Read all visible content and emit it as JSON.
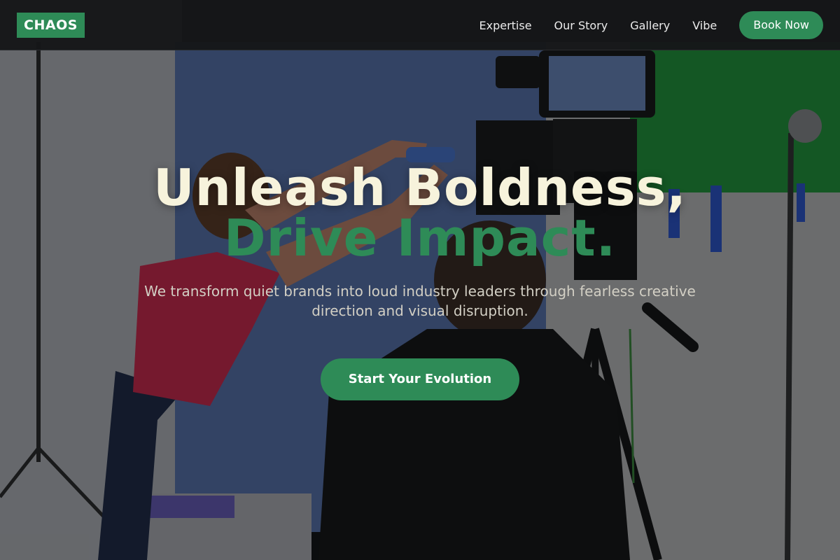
{
  "brand": {
    "logo_text": "CHAOS",
    "accent_color": "#2e8b57"
  },
  "nav": {
    "links": [
      {
        "label": "Expertise"
      },
      {
        "label": "Our Story"
      },
      {
        "label": "Gallery"
      },
      {
        "label": "Vibe"
      }
    ],
    "cta_label": "Book Now"
  },
  "hero": {
    "headline_line1": "Unleash Boldness,",
    "headline_line2": "Drive Impact.",
    "subtext": "We transform quiet brands into loud industry leaders through fearless creative direction and visual disruption.",
    "cta_label": "Start Your Evolution",
    "background": "film-set-photo"
  }
}
